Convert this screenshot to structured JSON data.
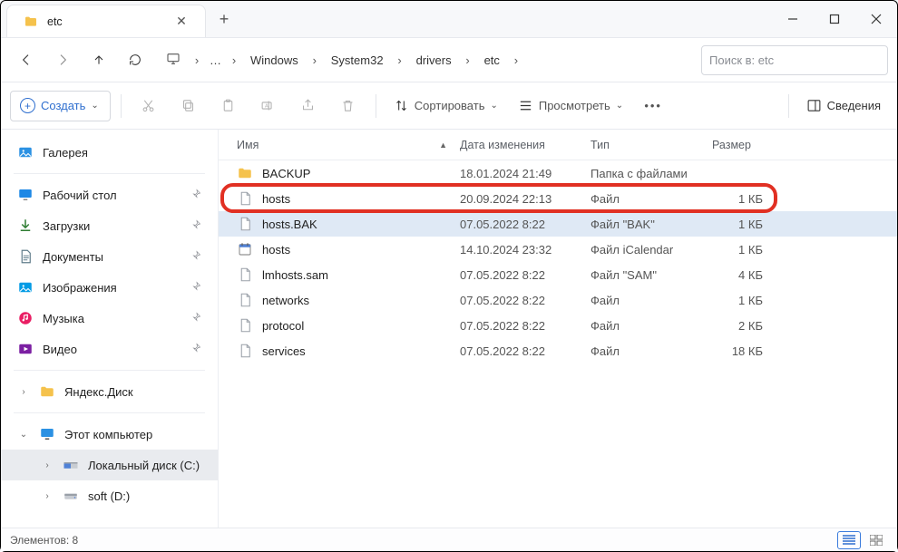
{
  "titlebar": {
    "tab_label": "etc"
  },
  "nav": {
    "breadcrumbs": [
      "Windows",
      "System32",
      "drivers",
      "etc"
    ],
    "search_placeholder": "Поиск в: etc"
  },
  "toolbar": {
    "create_label": "Создать",
    "sort_label": "Сортировать",
    "view_label": "Просмотреть",
    "details_label": "Сведения"
  },
  "sidebar": {
    "gallery": "Галерея",
    "pinned": [
      {
        "label": "Рабочий стол",
        "icon": "desktop",
        "color": "#1e88e5"
      },
      {
        "label": "Загрузки",
        "icon": "download",
        "color": "#2e7d32"
      },
      {
        "label": "Документы",
        "icon": "document",
        "color": "#607d8b"
      },
      {
        "label": "Изображения",
        "icon": "pictures",
        "color": "#039be5"
      },
      {
        "label": "Музыка",
        "icon": "music",
        "color": "#e91e63"
      },
      {
        "label": "Видео",
        "icon": "video",
        "color": "#7b1fa2"
      }
    ],
    "yandex": "Яндекс.Диск",
    "this_pc": "Этот компьютер",
    "drives": [
      {
        "label": "Локальный диск (C:)",
        "selected": true
      },
      {
        "label": "soft (D:)",
        "selected": false
      }
    ]
  },
  "columns": {
    "name": "Имя",
    "date": "Дата изменения",
    "type": "Тип",
    "size": "Размер"
  },
  "files": [
    {
      "name": "BACKUP",
      "date": "18.01.2024 21:49",
      "type": "Папка с файлами",
      "size": "",
      "icon": "folder",
      "selected": false,
      "highlight": false
    },
    {
      "name": "hosts",
      "date": "20.09.2024 22:13",
      "type": "Файл",
      "size": "1 КБ",
      "icon": "file",
      "selected": false,
      "highlight": true
    },
    {
      "name": "hosts.BAK",
      "date": "07.05.2022 8:22",
      "type": "Файл \"BAK\"",
      "size": "1 КБ",
      "icon": "file",
      "selected": true,
      "highlight": false
    },
    {
      "name": "hosts",
      "date": "14.10.2024 23:32",
      "type": "Файл iCalendar",
      "size": "1 КБ",
      "icon": "calendar",
      "selected": false,
      "highlight": false
    },
    {
      "name": "lmhosts.sam",
      "date": "07.05.2022 8:22",
      "type": "Файл \"SAM\"",
      "size": "4 КБ",
      "icon": "file",
      "selected": false,
      "highlight": false
    },
    {
      "name": "networks",
      "date": "07.05.2022 8:22",
      "type": "Файл",
      "size": "1 КБ",
      "icon": "file",
      "selected": false,
      "highlight": false
    },
    {
      "name": "protocol",
      "date": "07.05.2022 8:22",
      "type": "Файл",
      "size": "2 КБ",
      "icon": "file",
      "selected": false,
      "highlight": false
    },
    {
      "name": "services",
      "date": "07.05.2022 8:22",
      "type": "Файл",
      "size": "18 КБ",
      "icon": "file",
      "selected": false,
      "highlight": false
    }
  ],
  "status": {
    "text": "Элементов: 8"
  }
}
